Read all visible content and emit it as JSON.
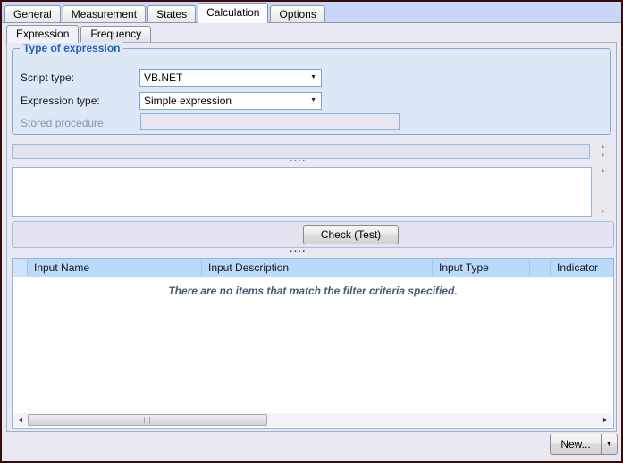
{
  "top_tabs": [
    "General",
    "Measurement",
    "States",
    "Calculation",
    "Options"
  ],
  "top_tabs_active": "Calculation",
  "sub_tabs": [
    "Expression",
    "Frequency"
  ],
  "sub_tabs_active": "Expression",
  "group": {
    "title": "Type of expression",
    "script_type": {
      "label": "Script type:",
      "value": "VB.NET"
    },
    "expression_type": {
      "label": "Expression type:",
      "value": "Simple expression"
    },
    "stored_procedure": {
      "label": "Stored procedure:",
      "value": ""
    }
  },
  "expression_editor": {
    "text": ""
  },
  "check_button_label": "Check (Test)",
  "splitter": {
    "dots": "····"
  },
  "grid": {
    "columns": {
      "input_name": "Input Name",
      "input_description": "Input Description",
      "input_type": "Input Type",
      "indicator": "Indicator"
    },
    "empty_message": "There are no items that match the filter criteria specified."
  },
  "new_button": {
    "label": "New..."
  },
  "icons": {
    "dropdown": "▼",
    "scroll_up": "▲",
    "scroll_down": "▼",
    "scroll_left": "◄",
    "scroll_right": "►",
    "thumb_grip": "|||"
  },
  "colors": {
    "tab_strip_blue": "#c9d6f8",
    "group_title_blue": "#2a5fb8",
    "grid_header_blue": "#badaf9",
    "window_border": "#380c08"
  }
}
